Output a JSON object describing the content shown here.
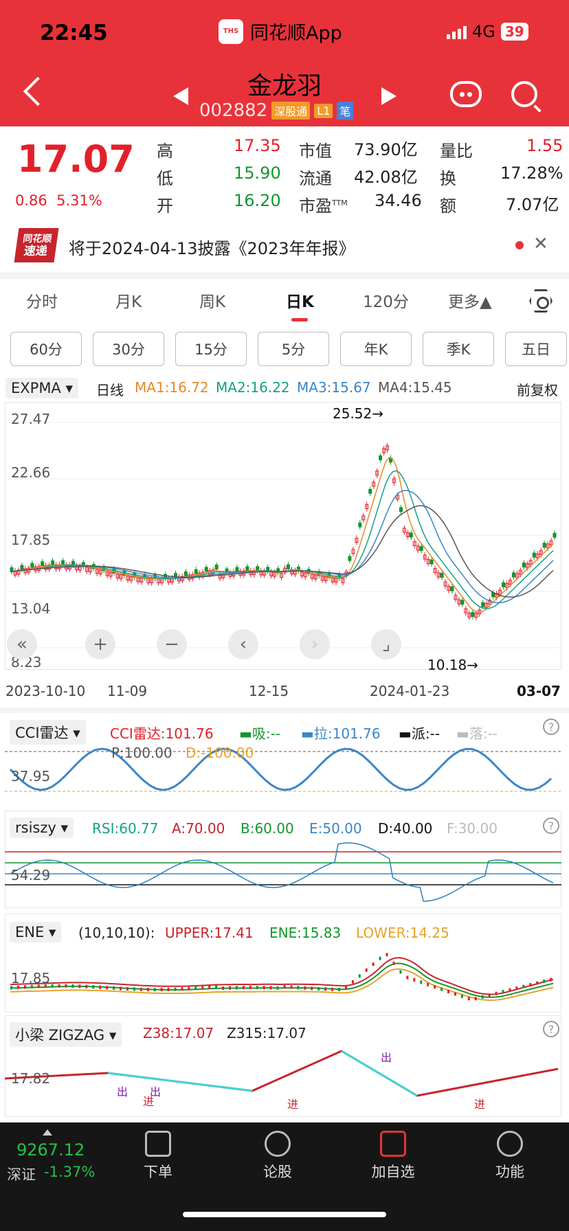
{
  "status": {
    "time": "22:45",
    "app": "同花顺App",
    "network": "4G",
    "battery": "39"
  },
  "stock": {
    "name": "金龙羽",
    "code": "002882",
    "tags": [
      "深股通",
      "L1",
      "笔"
    ]
  },
  "quote": {
    "price": "17.07",
    "change": "0.86",
    "pct": "5.31%",
    "high_label": "高",
    "high": "17.35",
    "low_label": "低",
    "low": "15.90",
    "open_label": "开",
    "open": "16.20",
    "mcap_label": "市值",
    "mcap": "73.90亿",
    "float_label": "流通",
    "float": "42.08亿",
    "pe_label": "市盈",
    "pe_sup": "TTM",
    "pe": "34.46",
    "vr_label": "量比",
    "vr": "1.55",
    "turn_label": "换",
    "turn": "17.28%",
    "amt_label": "额",
    "amt": "7.07亿"
  },
  "notice": {
    "logo_top": "同花顺",
    "logo_bottom": "速递",
    "text": "将于2024-04-13披露《2023年年报》",
    "close": "✕"
  },
  "tabs": [
    "分时",
    "月K",
    "周K",
    "日K",
    "120分",
    "更多▲"
  ],
  "subtabs": [
    "60分",
    "30分",
    "15分",
    "5分",
    "年K",
    "季K",
    "五日"
  ],
  "kline": {
    "indicator": "EXPMA ▾",
    "period": "日线",
    "ma1": "MA1:16.72",
    "ma2": "MA2:16.22",
    "ma3": "MA3:15.67",
    "ma4": "MA4:15.45",
    "adjust": "前复权",
    "y_labels": [
      "27.47",
      "22.66",
      "17.85",
      "13.04",
      "8.23"
    ],
    "max_note": "25.52→",
    "min_note": "10.18→",
    "x_labels": [
      "2023-10-10",
      "11-09",
      "12-15",
      "2024-01-23",
      "03-07"
    ]
  },
  "controls": [
    "«",
    "+",
    "−",
    "‹",
    "›",
    "⌟"
  ],
  "cci": {
    "selector": "CCI雷达 ▾",
    "value": "CCI雷达:101.76",
    "xi": "▬吸:--",
    "la": "▬拉:101.76",
    "pai": "▬派:--",
    "luo": "▬落:--",
    "p": "P:100.00",
    "d": "D:-100.00",
    "y": "37.95"
  },
  "rsi": {
    "selector": "rsiszy ▾",
    "rsi": "RSI:60.77",
    "a": "A:70.00",
    "b": "B:60.00",
    "e": "E:50.00",
    "d": "D:40.00",
    "f": "F:30.00",
    "y": "54.29"
  },
  "ene": {
    "selector": "ENE ▾",
    "params": "(10,10,10):",
    "upper": "UPPER:17.41",
    "ene": "ENE:15.83",
    "lower": "LOWER:14.25",
    "y": "17.85"
  },
  "zigzag": {
    "selector": "小梁 ZIGZAG ▾",
    "z38": "Z38:17.07",
    "z315": "Z315:17.07",
    "y": "17.82",
    "marks": [
      "出",
      "出",
      "进",
      "进",
      "出",
      "进"
    ]
  },
  "bottom": {
    "index_value": "9267.12",
    "index_name": "深证",
    "index_pct": "-1.37%",
    "nav": [
      "下单",
      "论股",
      "加自选",
      "功能"
    ]
  },
  "help": "?"
}
